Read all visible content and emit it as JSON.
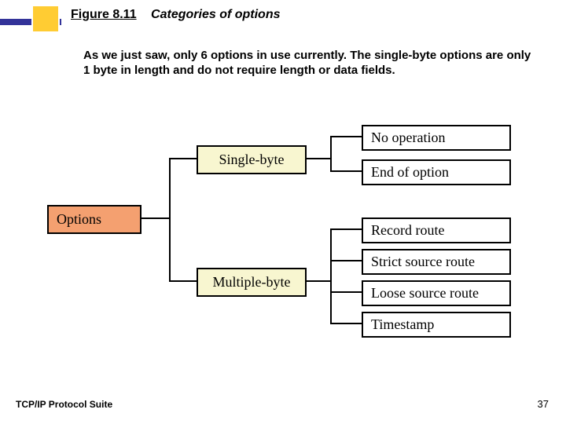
{
  "header": {
    "figure_label": "Figure 8.11",
    "figure_caption": "Categories of options"
  },
  "body": {
    "paragraph": "As we just saw, only 6 options in use currently.  The single-byte options are only 1 byte in length and do not require length or data fields."
  },
  "diagram": {
    "root": "Options",
    "single_byte": {
      "label": "Single-byte",
      "children": [
        "No operation",
        "End of option"
      ]
    },
    "multiple_byte": {
      "label": "Multiple-byte",
      "children": [
        "Record route",
        "Strict source route",
        "Loose source route",
        "Timestamp"
      ]
    }
  },
  "footer": {
    "left": "TCP/IP Protocol Suite",
    "page": "37"
  },
  "colors": {
    "accent_blue": "#333399",
    "accent_yellow": "#ffcc33",
    "box_root": "#f4a070",
    "box_cat": "#f8f6d0"
  }
}
